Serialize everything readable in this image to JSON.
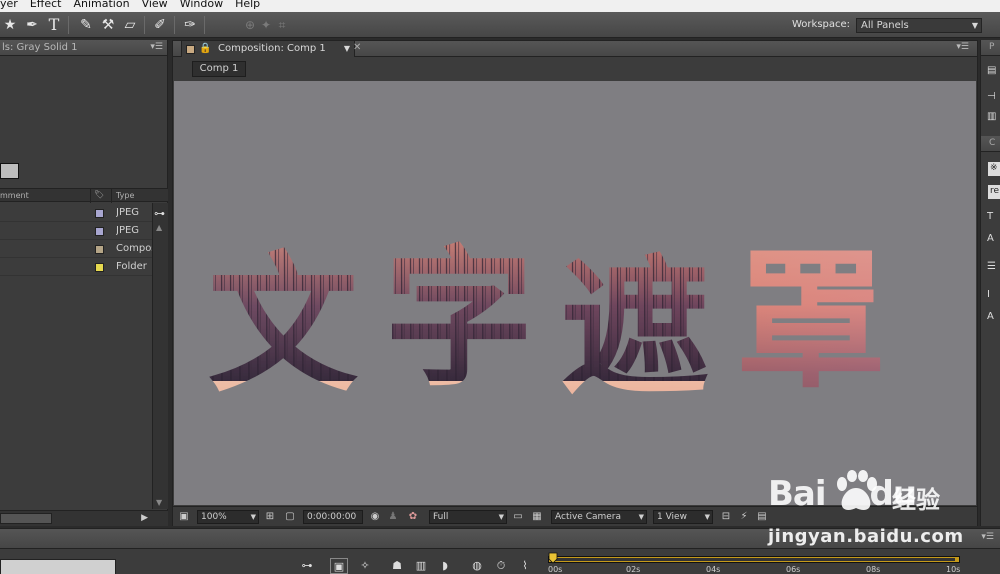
{
  "menu": [
    "yer",
    "Effect",
    "Animation",
    "View",
    "Window",
    "Help"
  ],
  "toolbar": {
    "workspace_label": "Workspace:",
    "workspace_value": "All Panels"
  },
  "project": {
    "tab_title": "ls: Gray Solid 1",
    "col_comment": "mment",
    "col_type": "Type",
    "rows": [
      {
        "type": "JPEG",
        "label_color": "#a8a6d0"
      },
      {
        "type": "JPEG",
        "label_color": "#a8a6d0"
      },
      {
        "type": "Compos",
        "label_color": "#b5a587"
      },
      {
        "type": "Folder",
        "label_color": "#e6d94f"
      }
    ]
  },
  "composition": {
    "tab_title": "Composition: Comp 1",
    "chip": "Comp 1",
    "text": [
      "文",
      "字",
      "遮",
      "罩"
    ],
    "bg_color": "#7f7e82"
  },
  "footer": {
    "zoom": "100%",
    "timecode": "0:00:00:00",
    "resolution": "Full",
    "camera": "Active Camera",
    "view": "1 View"
  },
  "timeline": {
    "ticks": [
      "00s",
      "02s",
      "04s",
      "06s",
      "08s",
      "10s"
    ]
  },
  "watermark": {
    "brand": "Bai",
    "brand2": "du",
    "cn": "经验",
    "url": "jingyan.baidu.com"
  }
}
